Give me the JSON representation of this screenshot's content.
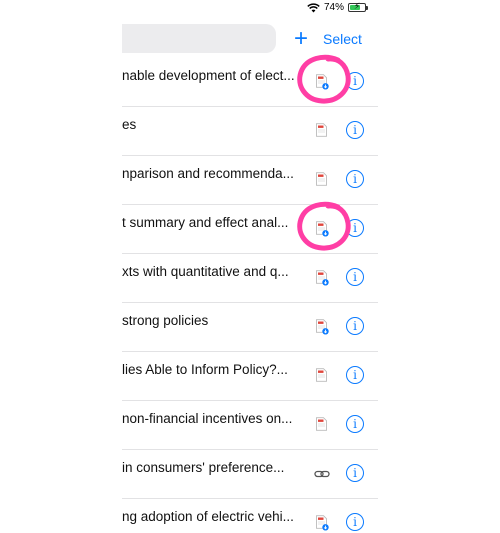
{
  "status_bar": {
    "battery_percent": "74%",
    "battery_level": 0.74,
    "charging": true,
    "wifi_icon": "wifi-icon"
  },
  "toolbar": {
    "add_label": "+",
    "select_label": "Select"
  },
  "rows": [
    {
      "title": "nable development of elect...",
      "icon": "pdf-cloud",
      "annotated": true
    },
    {
      "title": "es",
      "icon": "pdf",
      "annotated": false
    },
    {
      "title": "nparison and recommenda...",
      "icon": "pdf",
      "annotated": false
    },
    {
      "title": "t summary and effect anal...",
      "icon": "pdf-cloud",
      "annotated": true
    },
    {
      "title": "xts with quantitative and q...",
      "icon": "pdf-cloud",
      "annotated": false
    },
    {
      "title": " strong policies",
      "icon": "pdf-cloud",
      "annotated": false
    },
    {
      "title": "lies Able to Inform Policy?...",
      "icon": "pdf",
      "annotated": false
    },
    {
      "title": "non-financial incentives on...",
      "icon": "pdf",
      "annotated": false
    },
    {
      "title": " in consumers' preference...",
      "icon": "link",
      "annotated": false
    },
    {
      "title": "ng adoption of electric vehi...",
      "icon": "pdf-cloud",
      "annotated": false
    }
  ],
  "info_glyph": "i",
  "colors": {
    "accent": "#0a7aff",
    "annotation": "#ff3ea5",
    "pdf_red": "#e0463c"
  }
}
